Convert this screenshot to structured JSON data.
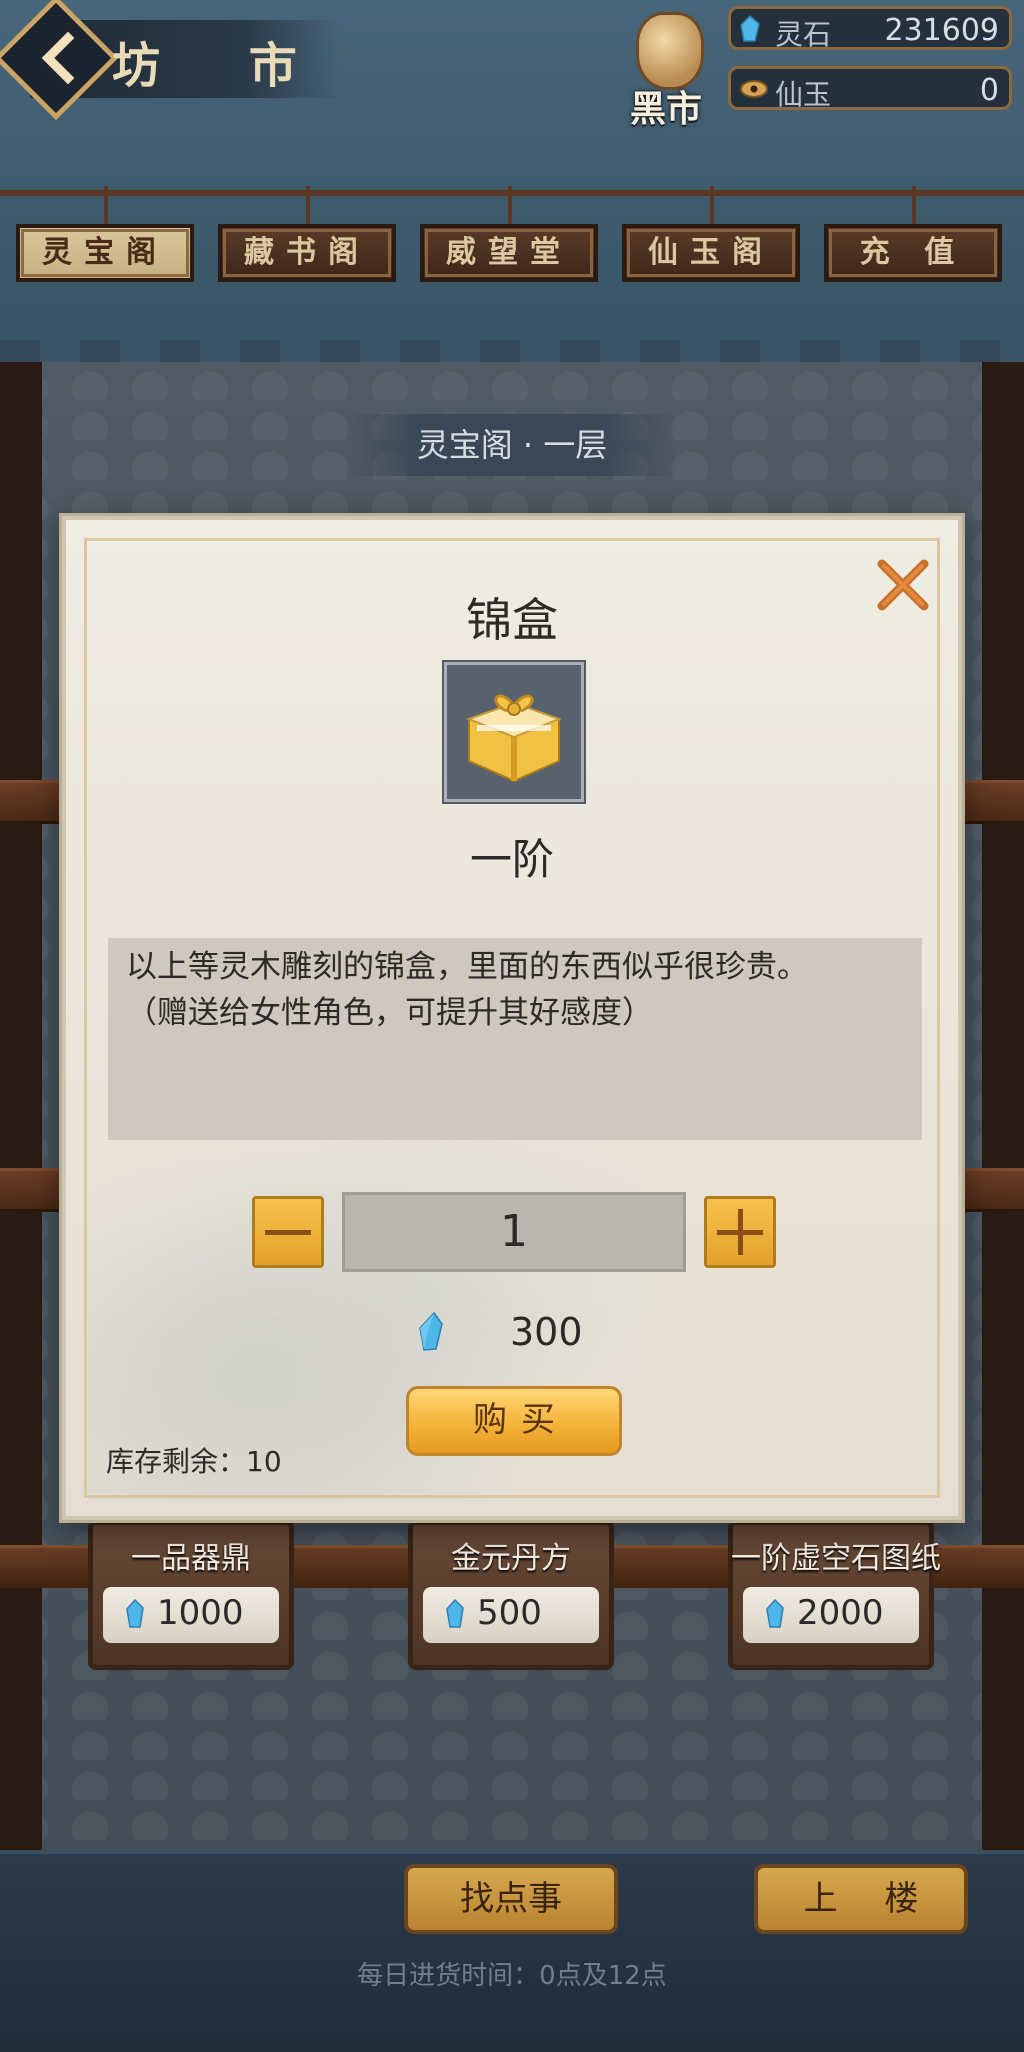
{
  "header": {
    "back_icon": "chevron-left-icon",
    "title": "坊 市",
    "black_market_label": "黑市",
    "currencies": [
      {
        "icon": "spirit-stone-icon",
        "label": "灵石",
        "value": "231609",
        "color": "#6fc3e8"
      },
      {
        "icon": "immortal-jade-icon",
        "label": "仙玉",
        "value": "0",
        "color": "#d6a253"
      }
    ]
  },
  "tabs": [
    {
      "label": "灵宝阁",
      "active": true
    },
    {
      "label": "藏书阁",
      "active": false
    },
    {
      "label": "威望堂",
      "active": false
    },
    {
      "label": "仙玉阁",
      "active": false
    },
    {
      "label": "充 值",
      "active": false
    }
  ],
  "floor_label": "灵宝阁 · 一层",
  "modal": {
    "item_name": "锦盒",
    "item_icon": "gift-box-icon",
    "grade": "一阶",
    "description_line1": "以上等灵木雕刻的锦盒，里面的东西似乎很珍贵。",
    "description_line2": "（赠送给女性角色，可提升其好感度）",
    "quantity": "1",
    "price": "300",
    "buy_label": "购买",
    "stock_text": "库存剩余：10"
  },
  "shelf_items": [
    {
      "name": "一品器鼎",
      "price": "1000"
    },
    {
      "name": "金元丹方",
      "price": "500"
    },
    {
      "name": "一阶虚空石图纸",
      "price": "2000"
    }
  ],
  "footer": {
    "find_task_label": "找点事",
    "upstairs_label": "上 楼",
    "daily_note": "每日进货时间：0点及12点"
  },
  "colors": {
    "accent_gold": "#f4b33a",
    "gem_blue": "#4fb6ea",
    "tab_active": "#d9c79c"
  }
}
